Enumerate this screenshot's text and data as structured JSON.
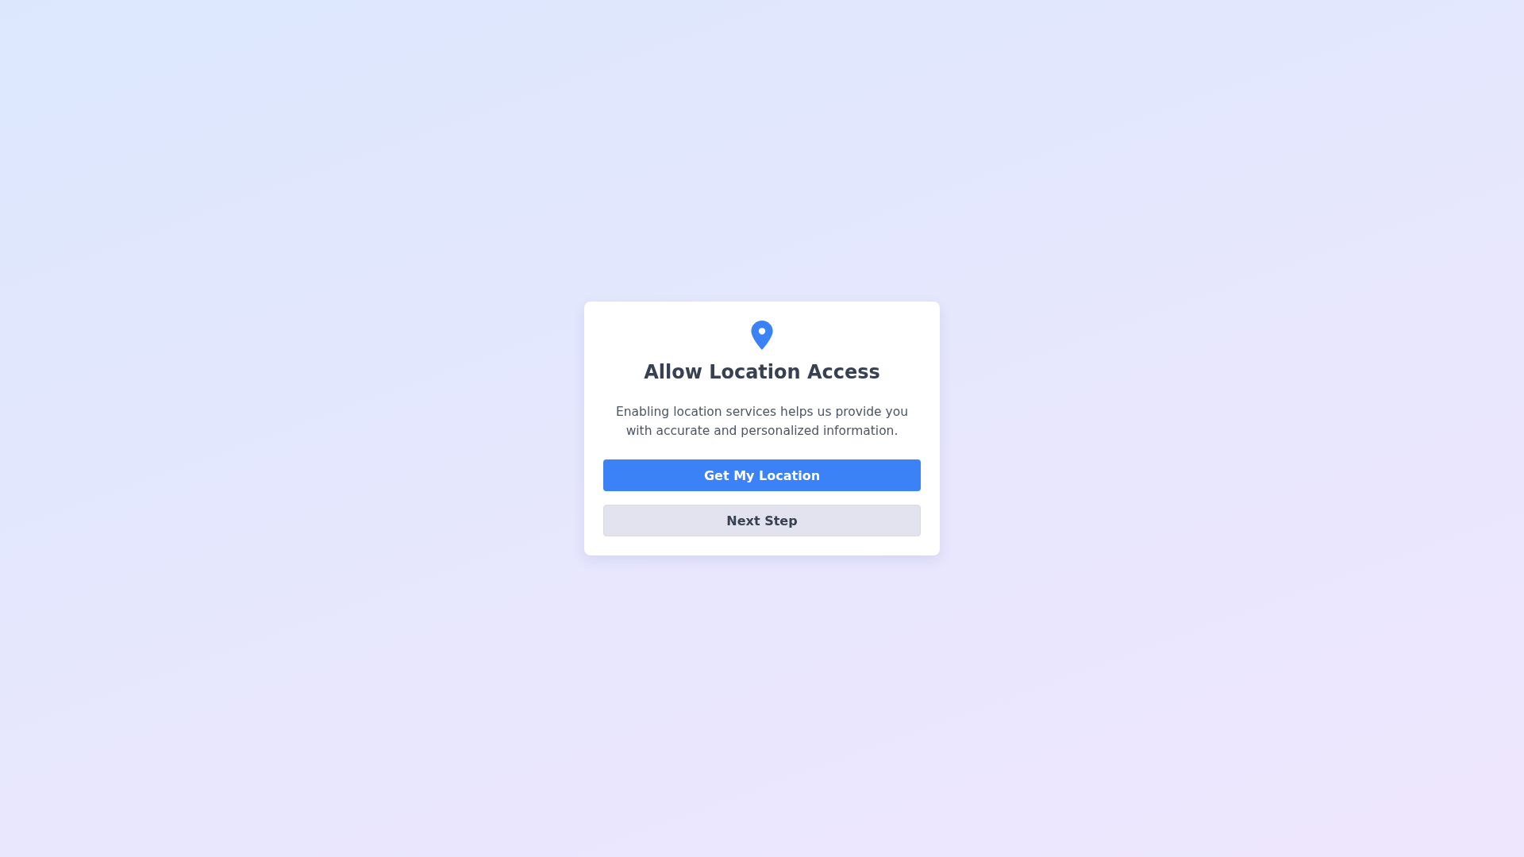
{
  "dialog": {
    "title": "Allow Location Access",
    "description": "Enabling location services helps us provide you with accurate and personalized information.",
    "buttons": [
      {
        "label": "Get My Location",
        "kind": "primary",
        "disabled": false
      },
      {
        "label": "Next Step",
        "kind": "secondary",
        "disabled": true
      }
    ]
  }
}
